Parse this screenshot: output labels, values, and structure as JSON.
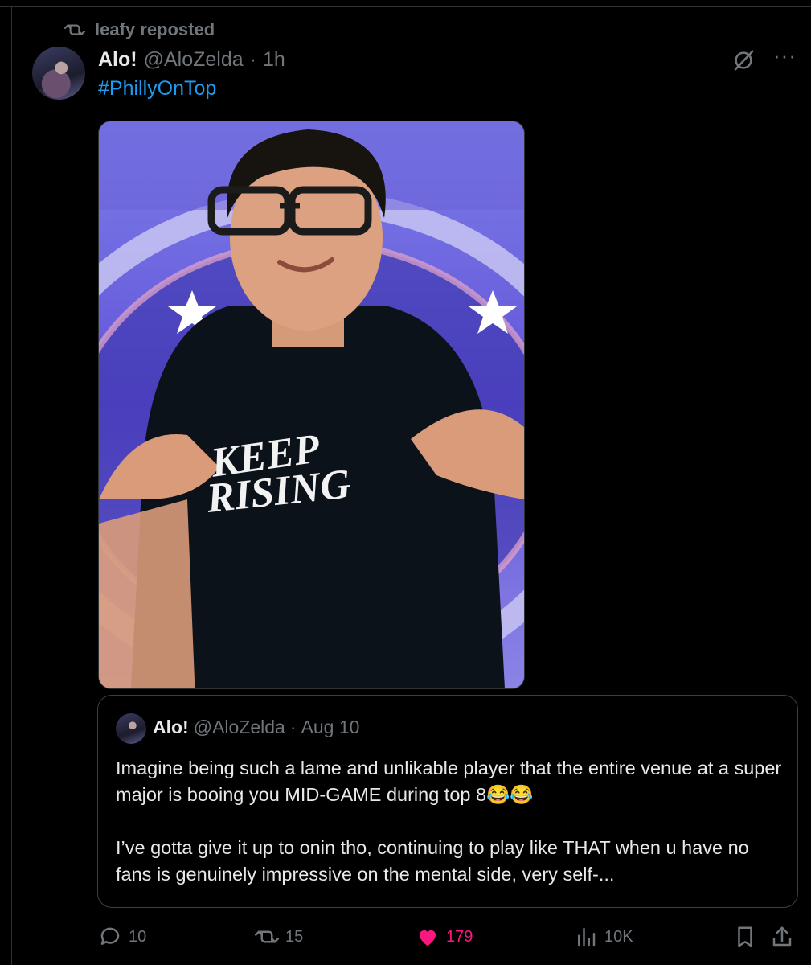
{
  "repost": {
    "label": "leafy reposted"
  },
  "tweet": {
    "display_name": "Alo!",
    "handle": "@AloZelda",
    "separator": "·",
    "time": "1h",
    "hashtag": "#PhillyOnTop",
    "image_shirt_text": [
      "KEEP",
      "RISING"
    ]
  },
  "quote": {
    "display_name": "Alo!",
    "handle": "@AloZelda",
    "separator": "·",
    "date": "Aug 10",
    "paragraph1": "Imagine being such a lame and unlikable player that the entire venue at a super major is booing you MID-GAME during top 8😂😂",
    "paragraph2": "I’ve gotta give it up to onin tho, continuing to play like THAT when u have no fans is genuinely impressive on the mental side, very self-..."
  },
  "actions": {
    "replies": "10",
    "reposts": "15",
    "likes": "179",
    "views": "10K"
  },
  "colors": {
    "background": "#000000",
    "muted": "#71767b",
    "link": "#1d9bf0",
    "like": "#f91880",
    "border": "#2f3336"
  },
  "icons": [
    "repost-icon",
    "grok-icon",
    "more-icon",
    "reply-icon",
    "like-icon",
    "views-icon",
    "bookmark-icon",
    "share-icon"
  ]
}
